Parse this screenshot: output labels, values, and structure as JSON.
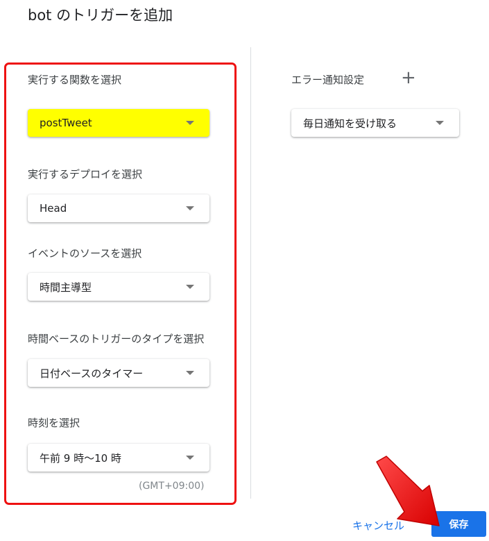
{
  "header": {
    "title": "bot のトリガーを追加"
  },
  "form": {
    "function_label": "実行する関数を選択",
    "function_value": "postTweet",
    "deployment_label": "実行するデプロイを選択",
    "deployment_value": "Head",
    "event_source_label": "イベントのソースを選択",
    "event_source_value": "時間主導型",
    "trigger_type_label": "時間ベースのトリガーのタイプを選択",
    "trigger_type_value": "日付ベースのタイマー",
    "time_label": "時刻を選択",
    "time_value": "午前 9 時～10 時",
    "timezone": "(GMT+09:00)"
  },
  "notification": {
    "label": "エラー通知設定",
    "add_symbol": "+",
    "value": "毎日通知を受け取る"
  },
  "footer": {
    "cancel_label": "キャンセル",
    "save_label": "保存"
  },
  "colors": {
    "highlight": "#ffff00",
    "frame": "#ee1111",
    "primary": "#1a73e8",
    "arrow": "#ff1a1a"
  }
}
